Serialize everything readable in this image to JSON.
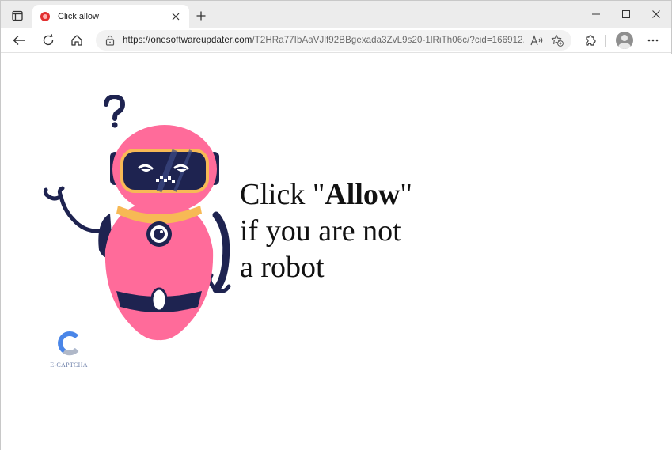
{
  "browser": {
    "tab": {
      "title": "Click allow"
    },
    "address": {
      "host": "https://onesoftwareupdater.com",
      "path": "/T2HRa77IbAaVJlf92BBgexada3ZvL9s20-1lRiTh06c/?cid=166912..."
    }
  },
  "page": {
    "headline": {
      "prefix": "Click \"",
      "bold": "Allow",
      "suffix": "\"",
      "line2": "if you are not",
      "line3": "a robot"
    },
    "captcha": {
      "label": "E-CAPTCHA"
    }
  },
  "colors": {
    "robot_body": "#ff6b9a",
    "robot_dark": "#1e2350",
    "robot_collar": "#f7b955",
    "captcha_blue": "#4a86e8"
  }
}
